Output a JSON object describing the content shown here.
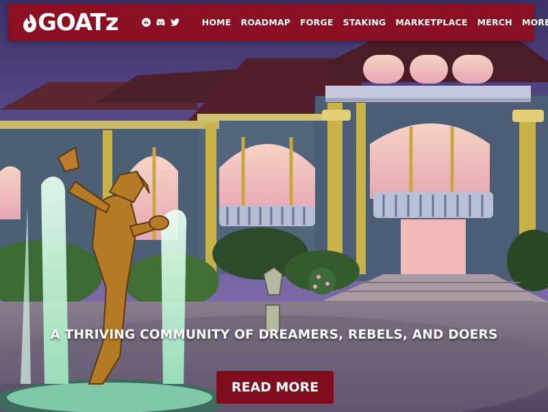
{
  "brand": {
    "name": "GOATz"
  },
  "social": {
    "icons": [
      "opensea-icon",
      "discord-icon",
      "twitter-icon"
    ]
  },
  "nav": {
    "items": [
      {
        "label": "HOME"
      },
      {
        "label": "ROADMAP"
      },
      {
        "label": "FORGE"
      },
      {
        "label": "STAKING"
      },
      {
        "label": "MARKETPLACE"
      },
      {
        "label": "MERCH"
      },
      {
        "label": "MORE"
      }
    ]
  },
  "hero": {
    "tagline": "A THRIVING COMMUNITY OF DREAMERS, REBELS, AND DOERS",
    "cta_label": "READ MORE"
  },
  "colors": {
    "nav_bg": "#8a0f22",
    "button_bg": "#7f0d1e",
    "text": "#ffffff"
  }
}
